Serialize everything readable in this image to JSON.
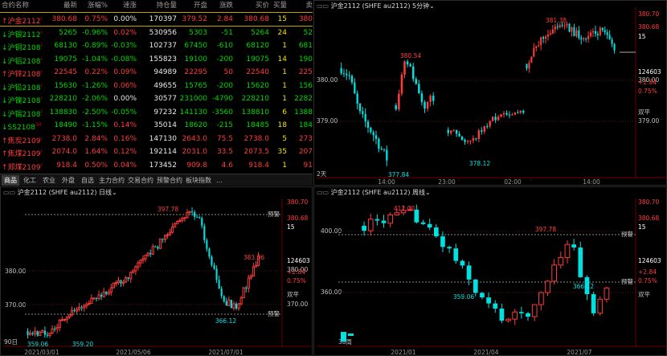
{
  "colors": {
    "up": "#ff3b3b",
    "down": "#00e0e0",
    "bg": "#000000",
    "grid": "#5a1010"
  },
  "quote": {
    "headers": [
      "合约名称",
      "最新",
      "涨幅%",
      "速涨",
      "持仓量",
      "开盘",
      "涨跌",
      "买价",
      "买量",
      "卖"
    ],
    "rows": [
      {
        "name": "沪金2112",
        "mark": "↑",
        "sup": "ℓ",
        "dir": "up",
        "last": "380.68",
        "chg_pct": "0.75%",
        "speed": "0.00%",
        "oi": "170397",
        "open": "379.52",
        "chg": "2.84",
        "bid": "380.68",
        "bidvol": "15",
        "ask": "380"
      },
      {
        "name": "沪银2112",
        "mark": "↓",
        "sup": "ℓ",
        "dir": "down",
        "last": "5265",
        "chg_pct": "-0.96%",
        "speed": "0.02%",
        "oi": "530956",
        "open": "5303",
        "chg": "-51",
        "bid": "5264",
        "bidvol": "24",
        "ask": "52"
      },
      {
        "name": "沪铜2108",
        "mark": "↓",
        "sup": "ℓ",
        "dir": "down",
        "last": "68130",
        "chg_pct": "-0.89%",
        "speed": "-0.03%",
        "oi": "102737",
        "open": "67450",
        "chg": "-610",
        "bid": "68120",
        "bidvol": "1",
        "ask": "681"
      },
      {
        "name": "沪铝2108",
        "mark": "↓",
        "sup": "ℓ",
        "dir": "down",
        "last": "19075",
        "chg_pct": "-1.04%",
        "speed": "-0.08%",
        "oi": "155823",
        "open": "19100",
        "chg": "-200",
        "bid": "19075",
        "bidvol": "14",
        "ask": "190"
      },
      {
        "name": "沪锌2108",
        "mark": "↑",
        "sup": "ℓ",
        "dir": "up",
        "last": "22545",
        "chg_pct": "0.22%",
        "speed": "0.09%",
        "oi": "94989",
        "open": "22295",
        "chg": "50",
        "bid": "22540",
        "bidvol": "1",
        "ask": "225"
      },
      {
        "name": "沪铅2108",
        "mark": "↓",
        "sup": "ℓ",
        "dir": "down",
        "last": "15630",
        "chg_pct": "-1.26%",
        "speed": "0.06%",
        "oi": "49655",
        "open": "15765",
        "chg": "-200",
        "bid": "15620",
        "bidvol": "1",
        "ask": "156"
      },
      {
        "name": "沪镍2108",
        "mark": "↓",
        "sup": "ℓ",
        "dir": "down",
        "last": "228210",
        "chg_pct": "-2.06%",
        "speed": "0.00%",
        "oi": "30577",
        "open": "231000",
        "chg": "-4790",
        "bid": "228210",
        "bidvol": "1",
        "ask": "2282"
      },
      {
        "name": "沪锡2108",
        "mark": "↓",
        "sup": "ℓ",
        "dir": "down",
        "last": "138830",
        "chg_pct": "-2.50%",
        "speed": "-0.05%",
        "oi": "97232",
        "open": "141130",
        "chg": "-3560",
        "bid": "138810",
        "bidvol": "6",
        "ask": "1388"
      },
      {
        "name": "SS2108",
        "mark": "↓",
        "sup": "SM",
        "dir": "down",
        "last": "18490",
        "chg_pct": "-1.15%",
        "speed": "0.14%",
        "oi": "35014",
        "open": "18620",
        "chg": "-215",
        "bid": "18485",
        "bidvol": "18",
        "ask": "184"
      },
      {
        "name": "焦炭2109",
        "mark": "↑",
        "sup": "ℓ",
        "dir": "up",
        "last": "2738.0",
        "chg_pct": "2.84%",
        "speed": "0.16%",
        "oi": "147130",
        "open": "2643.0",
        "chg": "75.5",
        "bid": "2738.0",
        "bidvol": "5",
        "ask": "273"
      },
      {
        "name": "焦煤2109",
        "mark": "↑",
        "sup": "ℓ",
        "dir": "up",
        "last": "2074.0",
        "chg_pct": "1.64%",
        "speed": "0.12%",
        "oi": "192114",
        "open": "2031.0",
        "chg": "33.5",
        "bid": "2073.5",
        "bidvol": "35",
        "ask": "207"
      },
      {
        "name": "郑煤2109",
        "mark": "↑",
        "sup": "ℓ",
        "dir": "up",
        "last": "918.4",
        "chg_pct": "0.50%",
        "speed": "0.04%",
        "oi": "173452",
        "open": "909.8",
        "chg": "4.6",
        "bid": "918.4",
        "bidvol": "1",
        "ask": "91"
      }
    ],
    "tabs": [
      "商品",
      "化工",
      "农业",
      "外盘",
      "自选",
      "主力合约",
      "交易合约",
      "预警合约",
      "板块指数",
      "..."
    ]
  },
  "min5": {
    "title": "沪金2112 (SHFE au2112)",
    "period": "5分钟",
    "axis": [
      "380.70",
      "380.68",
      "15",
      "380.00",
      "124603",
      "+2.84",
      "0.75%",
      "379.00",
      "双平"
    ],
    "times": [
      "14:00",
      "23:00",
      "02:00",
      "14:00"
    ],
    "day_label": "2天",
    "annotations": [
      "381.38",
      "380.54",
      "377.84",
      "378.12"
    ],
    "last_value": "380.68"
  },
  "daily": {
    "title": "沪金2112 (SHFE au2112)",
    "period": "日线",
    "axis": [
      "380.70",
      "380.68",
      "15",
      "380.00",
      "124603",
      "+2.84",
      "0.75%",
      "370.00",
      "双平"
    ],
    "dates": [
      "2021/03/01",
      "2021/05/06",
      "2021/07/01"
    ],
    "annotations": [
      "397.78",
      "383.06",
      "366.12",
      "359.20",
      "359.06"
    ],
    "alert_label": "预警",
    "bar_count": "90日"
  },
  "weekly": {
    "title": "沪金2112 (SHFE au2112)",
    "period": "周线",
    "axis": [
      "380.70",
      "380.68",
      "15",
      "400.00",
      "124603",
      "+2.84",
      "0.75%",
      "360.00",
      "双平"
    ],
    "dates": [
      "2021/01",
      "2021/04",
      "2021/07"
    ],
    "annotations": [
      "412.00",
      "397.78",
      "366.12",
      "359.06"
    ],
    "alert_label": "预警",
    "bar_count": "38周"
  },
  "chart_data": [
    {
      "type": "candlestick",
      "title": "沪金2112 5分钟",
      "ylim": [
        377.6,
        381.5
      ],
      "labels": {
        "high": 381.38,
        "low": 377.84
      }
    },
    {
      "type": "candlestick",
      "title": "沪金2112 日线",
      "ylim": [
        358,
        400
      ],
      "labels": {
        "high": 397.78,
        "low": 359.2
      }
    },
    {
      "type": "candlestick",
      "title": "沪金2112 周线",
      "ylim": [
        356,
        415
      ],
      "labels": {
        "high": 412,
        "low": 359.06
      }
    }
  ]
}
